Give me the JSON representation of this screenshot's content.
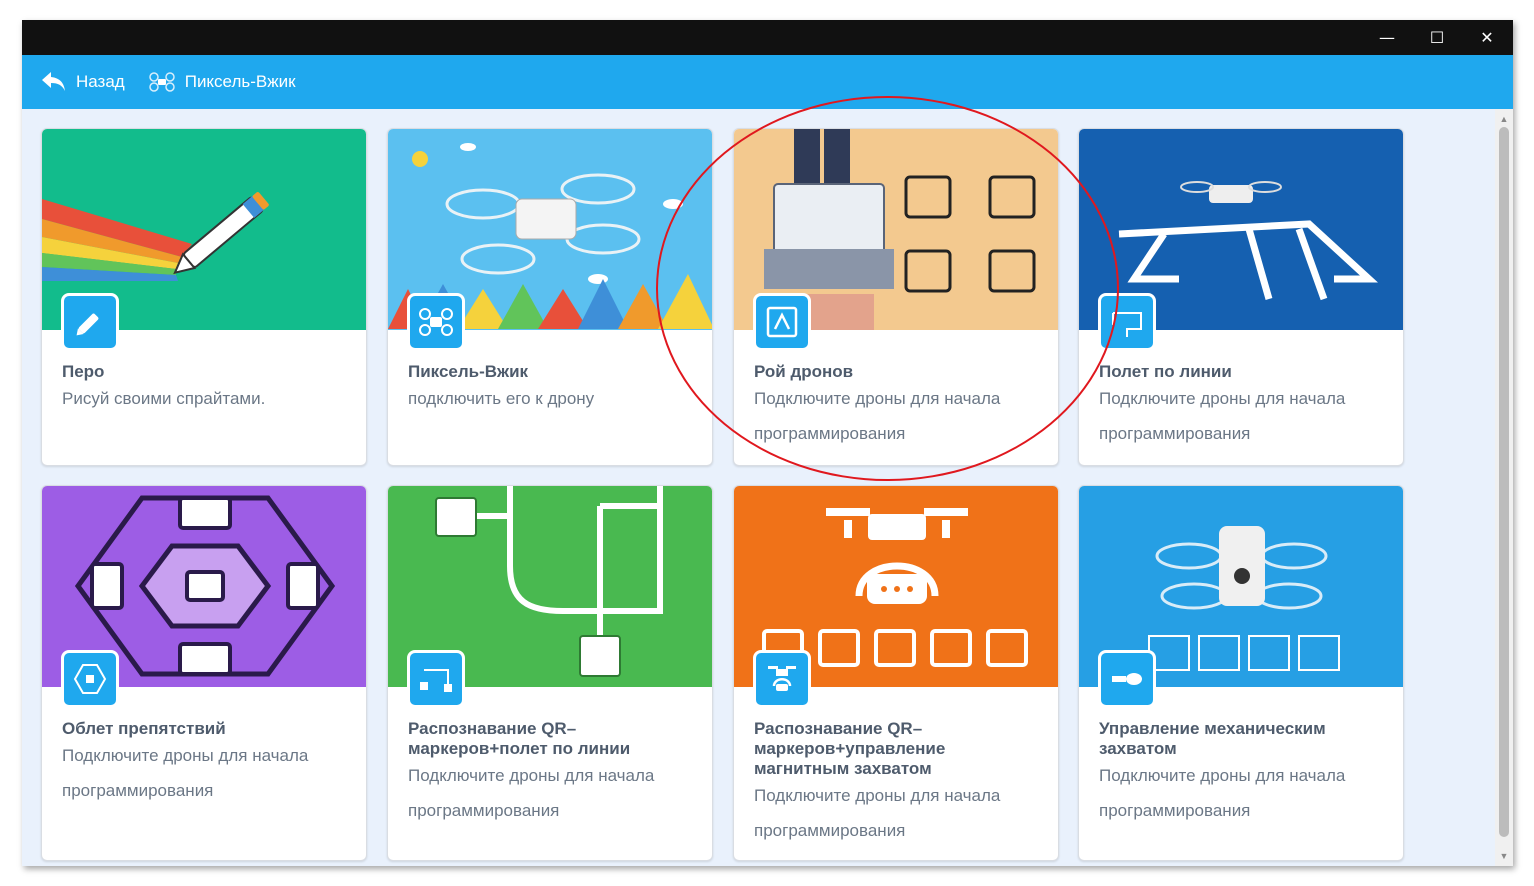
{
  "window": {
    "controls": {
      "minimize": "—",
      "maximize": "☐",
      "close": "✕"
    }
  },
  "appbar": {
    "back_label": "Назад",
    "breadcrumb_label": "Пиксель-Вжик"
  },
  "cards": [
    {
      "title": "Перо",
      "description": "Рисуй своими спрайтами.",
      "bg": "#12bc8c"
    },
    {
      "title": "Пиксель-Вжик",
      "description": "подключить его к дрону",
      "bg": "#5bc0f0"
    },
    {
      "title": "Рой дронов",
      "description": "Подключите дроны для начала программирования",
      "bg": "#f3c98f"
    },
    {
      "title": "Полет по линии",
      "description": "Подключите дроны для начала программирования",
      "bg": "#1560b0"
    },
    {
      "title": "Облет препятствий",
      "description": "Подключите дроны для начала программирования",
      "bg": "#9d5de5"
    },
    {
      "title": "Распознавание QR–маркеров+полет по линии",
      "description": "Подключите дроны для начала программирования",
      "bg": "#49b950"
    },
    {
      "title": "Распознавание QR–маркеров+управление магнитным захватом",
      "description": "Подключите дроны для начала программирования",
      "bg": "#f07218"
    },
    {
      "title": "Управление механическим захватом",
      "description": "Подключите дроны для начала программирования",
      "bg": "#269fe4"
    }
  ],
  "colors": {
    "accent": "#1fa8ee",
    "annotation": "#e0181e"
  }
}
